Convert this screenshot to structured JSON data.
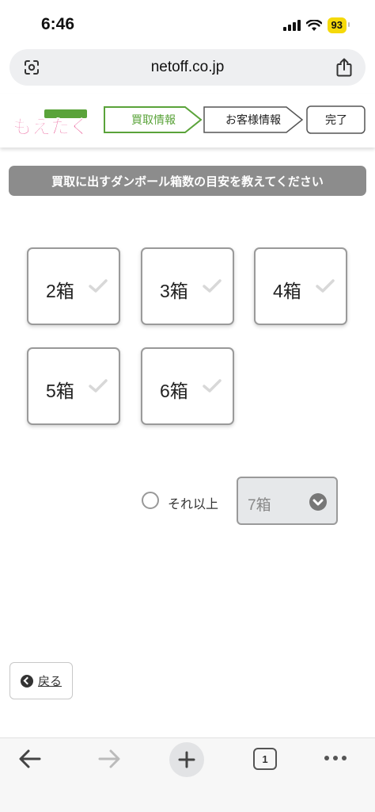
{
  "status_bar": {
    "time": "6:46",
    "battery": "93",
    "icons": [
      "signal-icon",
      "wifi-icon",
      "battery-icon"
    ]
  },
  "address_bar": {
    "url": "netoff.co.jp",
    "left_icon": "page-settings-icon",
    "right_icon": "share-icon"
  },
  "site": {
    "logo_text": "もえたく!",
    "steps": [
      {
        "label": "買取情報",
        "active": true
      },
      {
        "label": "お客様情報",
        "active": false
      },
      {
        "label": "完了",
        "active": false
      }
    ],
    "accent_color": "#5aa33a"
  },
  "main": {
    "instruction": "買取に出すダンボール箱数の目安を教えてください",
    "options": [
      {
        "label": "2箱",
        "selected": false
      },
      {
        "label": "3箱",
        "selected": false
      },
      {
        "label": "4箱",
        "selected": false
      },
      {
        "label": "5箱",
        "selected": false
      },
      {
        "label": "6箱",
        "selected": false
      }
    ],
    "other": {
      "label": "それ以上",
      "checked": false,
      "select_value": "7箱"
    },
    "back_label": "戻る"
  },
  "toolbar": {
    "tab_count": "1",
    "icons": [
      "back-arrow-icon",
      "forward-arrow-icon",
      "new-tab-plus-icon",
      "tabs-icon",
      "more-icon"
    ]
  }
}
